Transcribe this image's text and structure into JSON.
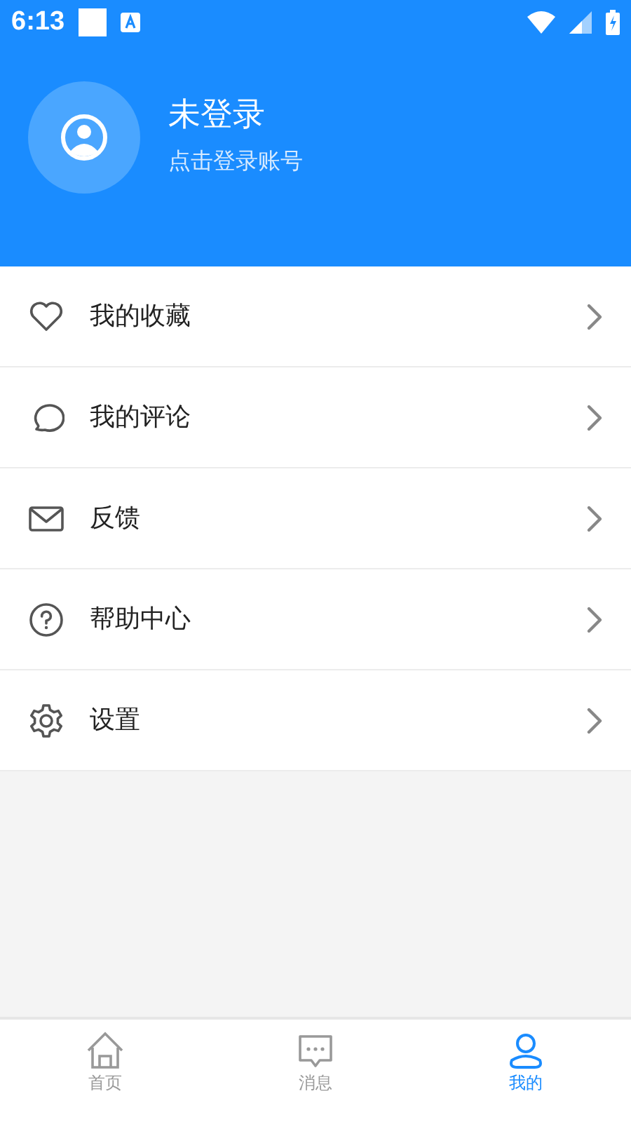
{
  "status_bar": {
    "time": "6:13"
  },
  "profile": {
    "title": "未登录",
    "subtitle": "点击登录账号"
  },
  "menu": [
    {
      "kind": "favorites",
      "label": "我的收藏"
    },
    {
      "kind": "comments",
      "label": "我的评论"
    },
    {
      "kind": "feedback",
      "label": "反馈"
    },
    {
      "kind": "help",
      "label": "帮助中心"
    },
    {
      "kind": "settings",
      "label": "设置"
    }
  ],
  "tabs": [
    {
      "kind": "home",
      "label": "首页",
      "selected": false
    },
    {
      "kind": "messages",
      "label": "消息",
      "selected": false
    },
    {
      "kind": "me",
      "label": "我的",
      "selected": true
    }
  ]
}
